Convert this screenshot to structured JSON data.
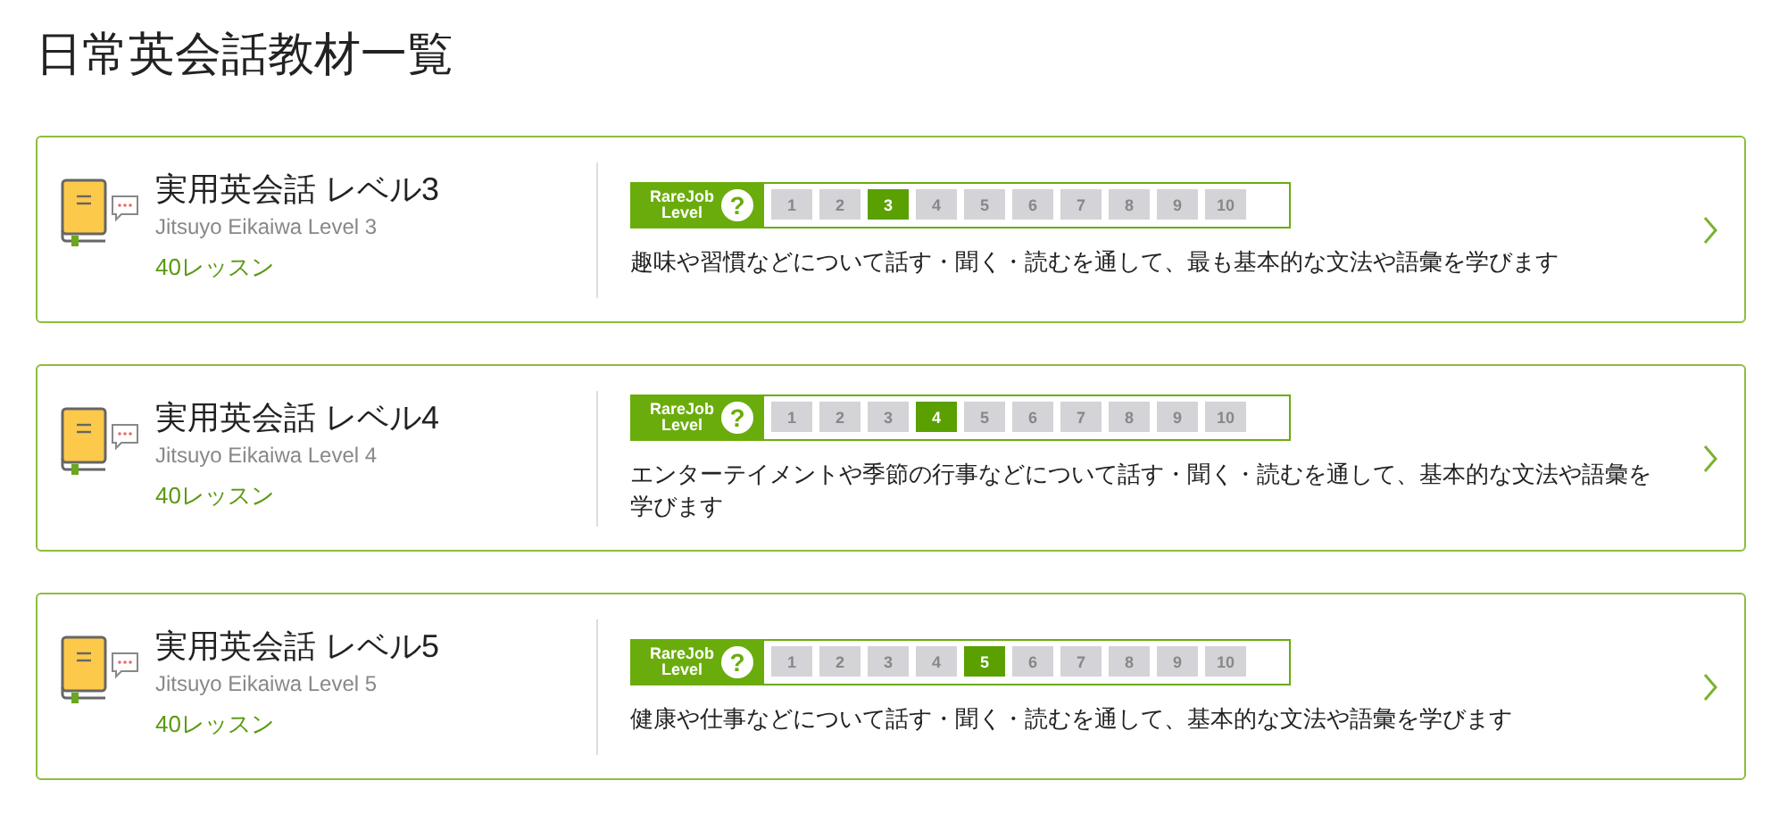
{
  "page_title": "日常英会話教材一覧",
  "courses": [
    {
      "title": "実用英会話 レベル3",
      "subtitle": "Jitsuyo Eikaiwa Level 3",
      "lessons": "40レッスン",
      "level_label_top": "RareJob",
      "level_label_bottom": "Level",
      "help": "?",
      "levels": [
        {
          "label": "1",
          "selected": false
        },
        {
          "label": "2",
          "selected": false
        },
        {
          "label": "3",
          "selected": true
        },
        {
          "label": "4",
          "selected": false
        },
        {
          "label": "5",
          "selected": false
        },
        {
          "label": "6",
          "selected": false
        },
        {
          "label": "7",
          "selected": false
        },
        {
          "label": "8",
          "selected": false
        },
        {
          "label": "9",
          "selected": false
        },
        {
          "label": "10",
          "selected": false
        }
      ],
      "description": "趣味や習慣などについて話す・聞く・読むを通して、最も基本的な文法や語彙を学びます"
    },
    {
      "title": "実用英会話 レベル4",
      "subtitle": "Jitsuyo Eikaiwa Level 4",
      "lessons": "40レッスン",
      "level_label_top": "RareJob",
      "level_label_bottom": "Level",
      "help": "?",
      "levels": [
        {
          "label": "1",
          "selected": false
        },
        {
          "label": "2",
          "selected": false
        },
        {
          "label": "3",
          "selected": false
        },
        {
          "label": "4",
          "selected": true
        },
        {
          "label": "5",
          "selected": false
        },
        {
          "label": "6",
          "selected": false
        },
        {
          "label": "7",
          "selected": false
        },
        {
          "label": "8",
          "selected": false
        },
        {
          "label": "9",
          "selected": false
        },
        {
          "label": "10",
          "selected": false
        }
      ],
      "description": "エンターテイメントや季節の行事などについて話す・聞く・読むを通して、基本的な文法や語彙を学びます"
    },
    {
      "title": "実用英会話 レベル5",
      "subtitle": "Jitsuyo Eikaiwa Level 5",
      "lessons": "40レッスン",
      "level_label_top": "RareJob",
      "level_label_bottom": "Level",
      "help": "?",
      "levels": [
        {
          "label": "1",
          "selected": false
        },
        {
          "label": "2",
          "selected": false
        },
        {
          "label": "3",
          "selected": false
        },
        {
          "label": "4",
          "selected": false
        },
        {
          "label": "5",
          "selected": true
        },
        {
          "label": "6",
          "selected": false
        },
        {
          "label": "7",
          "selected": false
        },
        {
          "label": "8",
          "selected": false
        },
        {
          "label": "9",
          "selected": false
        },
        {
          "label": "10",
          "selected": false
        }
      ],
      "description": "健康や仕事などについて話す・聞く・読むを通して、基本的な文法や語彙を学びます"
    }
  ]
}
